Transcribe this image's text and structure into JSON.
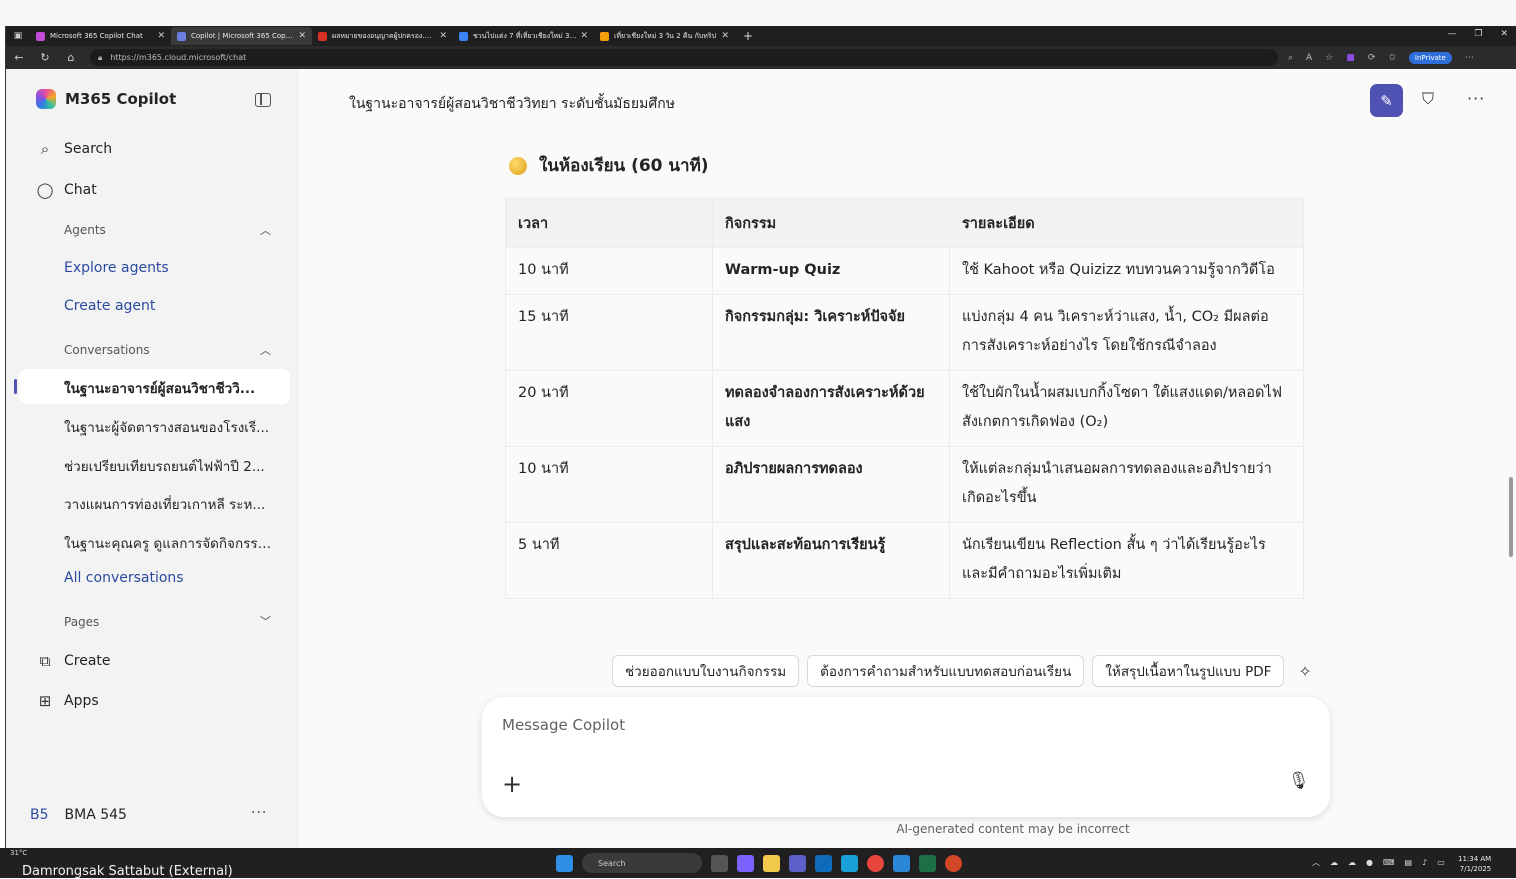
{
  "browser": {
    "tabs": [
      {
        "title": "Microsoft 365 Copilot Chat",
        "color": "#c04bd8",
        "active": false
      },
      {
        "title": "Copilot | Microsoft 365 Copilot",
        "color": "#6c7ee1",
        "active": true
      },
      {
        "title": "ผลหมายของอนุญาตผู้ปกครอง.pdf",
        "color": "#d93025",
        "active": false
      },
      {
        "title": "ชวนไปแต่ง 7 ที่เที่ยวเชียงใหม่ 3 วัน 2 คืน",
        "color": "#3b82f6",
        "active": false
      },
      {
        "title": "เที่ยวเชียงใหม่ 3 วัน 2 คืน กับทริป",
        "color": "#f59e0b",
        "active": false
      }
    ],
    "url": "https://m365.cloud.microsoft/chat",
    "inprivate_label": "InPrivate"
  },
  "sidebar": {
    "brand": "M365 Copilot",
    "search_label": "Search",
    "chat_label": "Chat",
    "agents_header": "Agents",
    "explore_agents": "Explore agents",
    "create_agent": "Create agent",
    "conversations_header": "Conversations",
    "conversations": [
      "ในฐานะอาจารย์ผู้สอนวิชาชีววิ...",
      "ในฐานะผู้จัดตารางสอนของโรงเรี...",
      "ช่วยเปรียบเทียบรถยนต์ไฟฟ้าปี 2...",
      "วางแผนการท่องเที่ยวเกาหลี ระห...",
      "ในฐานะคุณครู ดูแลการจัดกิจกรรม..."
    ],
    "all_conversations": "All conversations",
    "pages_header": "Pages",
    "create_label": "Create",
    "apps_label": "Apps",
    "user_initials": "B5",
    "user_name": "BMA 545"
  },
  "main": {
    "conversation_title": "ในฐานะอาจารย์ผู้สอนวิชาชีววิทยา ระดับชั้นมัธยมศึกษ",
    "section_heading": "ในห้องเรียน (60 นาที)",
    "table": {
      "headers": [
        "เวลา",
        "กิจกรรม",
        "รายละเอียด"
      ],
      "rows": [
        {
          "time": "10 นาที",
          "activity": "Warm-up Quiz",
          "detail": "ใช้ Kahoot หรือ Quizizz ทบทวนความรู้จากวิดีโอ"
        },
        {
          "time": "15 นาที",
          "activity": "กิจกรรมกลุ่ม: วิเคราะห์ปัจจัย",
          "detail": "แบ่งกลุ่ม 4 คน วิเคราะห์ว่าแสง, น้ำ, CO₂ มีผลต่อการสังเคราะห์อย่างไร โดยใช้กรณีจำลอง"
        },
        {
          "time": "20 นาที",
          "activity": "ทดลองจำลองการสังเคราะห์ด้วยแสง",
          "detail": "ใช้ใบผักในน้ำผสมเบกกิ้งโซดา ใต้แสงแดด/หลอดไฟ สังเกตการเกิดฟอง (O₂)"
        },
        {
          "time": "10 นาที",
          "activity": "อภิปรายผลการทดลอง",
          "detail": "ให้แต่ละกลุ่มนำเสนอผลการทดลองและอภิปรายว่าเกิดอะไรขึ้น"
        },
        {
          "time": "5 นาที",
          "activity": "สรุปและสะท้อนการเรียนรู้",
          "detail": "นักเรียนเขียน Reflection สั้น ๆ ว่าได้เรียนรู้อะไรและมีคำถามอะไรเพิ่มเติม"
        }
      ]
    },
    "suggestions": [
      "ช่วยออกแบบใบงานกิจกรรม",
      "ต้องการคำถามสำหรับแบบทดสอบก่อนเรียน",
      "ให้สรุปเนื้อหาในรูปแบบ PDF"
    ],
    "composer_placeholder": "Message Copilot",
    "disclaimer": "AI-generated content may be incorrect"
  },
  "taskbar": {
    "user_label": "Damrongsak Sattabut (External)",
    "weather": "31°C",
    "search_label": "Search",
    "time": "11:34 AM",
    "date": "7/1/2025"
  },
  "colors": {
    "accent": "#4f52b2",
    "link": "#2b4a9e",
    "sidebar_bg": "#f3f3f3",
    "main_bg": "#fafafa"
  }
}
